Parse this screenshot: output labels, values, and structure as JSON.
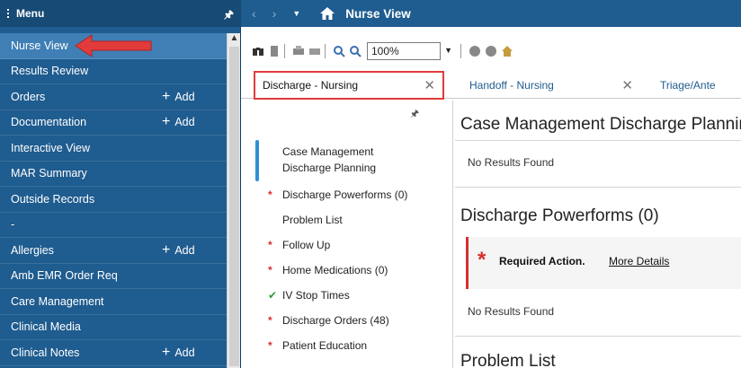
{
  "menu": {
    "title": "Menu",
    "items": [
      {
        "label": "Nurse View",
        "add": ""
      },
      {
        "label": "Results Review",
        "add": ""
      },
      {
        "label": "Orders",
        "add": "Add"
      },
      {
        "label": "Documentation",
        "add": "Add"
      },
      {
        "label": "Interactive View",
        "add": ""
      },
      {
        "label": "MAR Summary",
        "add": ""
      },
      {
        "label": "Outside Records",
        "add": ""
      },
      {
        "label": "-",
        "add": ""
      },
      {
        "label": "Allergies",
        "add": "Add"
      },
      {
        "label": "Amb EMR Order Req",
        "add": ""
      },
      {
        "label": "Care Management",
        "add": ""
      },
      {
        "label": "Clinical Media",
        "add": ""
      },
      {
        "label": "Clinical Notes",
        "add": "Add"
      }
    ]
  },
  "titlebar": {
    "title": "Nurse View"
  },
  "toolbar": {
    "zoom": "100%"
  },
  "tabs": [
    {
      "label": "Discharge - Nursing"
    },
    {
      "label": "Handoff - Nursing"
    },
    {
      "label": "Triage/Ante"
    }
  ],
  "nav": {
    "items": [
      {
        "label": "Case Management",
        "label2": "Discharge Planning",
        "mark": ""
      },
      {
        "label": "Discharge Powerforms (0)",
        "mark": "*"
      },
      {
        "label": "Problem List",
        "mark": ""
      },
      {
        "label": "Follow Up",
        "mark": "*"
      },
      {
        "label": "Home Medications (0)",
        "mark": "*"
      },
      {
        "label": "IV Stop Times",
        "mark": "✔"
      },
      {
        "label": "Discharge Orders (48)",
        "mark": "*"
      },
      {
        "label": "Patient Education",
        "mark": "*"
      }
    ]
  },
  "content": {
    "sections": [
      {
        "title": "Case Management Discharge Planning",
        "no_results": "No Results Found"
      },
      {
        "title": "Discharge Powerforms  (0)",
        "no_results": "No Results Found"
      },
      {
        "title": "Problem List"
      }
    ],
    "required": {
      "star": "*",
      "label": "Required Action.",
      "link": "More Details"
    }
  },
  "colors": {
    "menu_bg": "#1f5c8f",
    "active_item": "#3f7fb5",
    "required": "#d63030",
    "highlight": "#e23b3b"
  }
}
